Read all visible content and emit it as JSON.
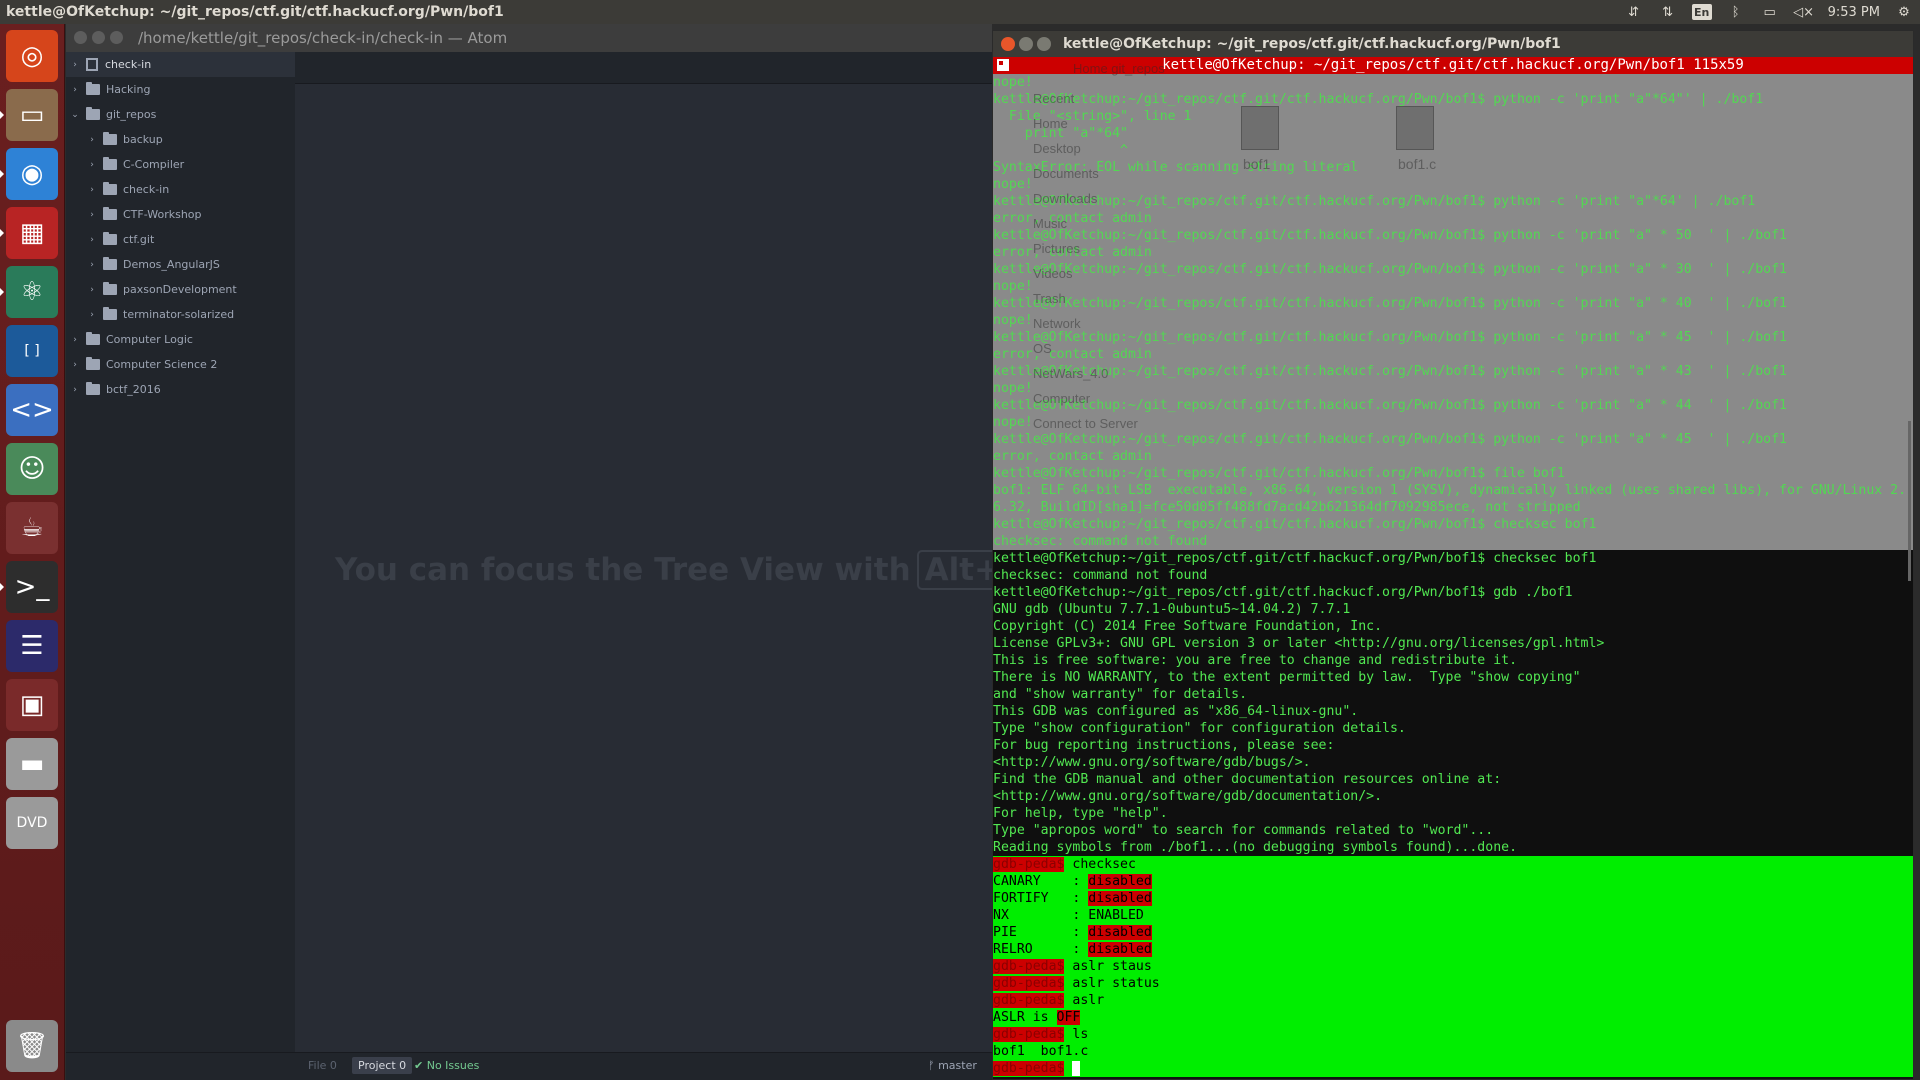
{
  "topbar": {
    "title": "kettle@OfKetchup: ~/git_repos/ctf.git/ctf.hackucf.org/Pwn/bof1",
    "keyboard": "En",
    "time": "9:53 PM",
    "icons": [
      "network-icon",
      "transfer-icon",
      "keyboard-icon",
      "bluetooth-icon",
      "battery-icon",
      "volume-muted-icon",
      "gear-icon"
    ]
  },
  "launcher": {
    "items": [
      {
        "name": "ubuntu-dash-icon",
        "color": "#d6451b",
        "glyph": "◎"
      },
      {
        "name": "files-icon",
        "color": "#8a6b4c",
        "glyph": "▭"
      },
      {
        "name": "chrome-icon",
        "color": "#2e82d6",
        "glyph": "◉"
      },
      {
        "name": "terminator-icon",
        "color": "#b82424",
        "glyph": "▦"
      },
      {
        "name": "atom-icon",
        "color": "#2a7b5a",
        "glyph": "⚛"
      },
      {
        "name": "brackets-icon",
        "color": "#1c5a9a",
        "glyph": "[ ]"
      },
      {
        "name": "code-editor-icon",
        "color": "#3b6fc0",
        "glyph": "<>"
      },
      {
        "name": "game-icon",
        "color": "#4a8a5a",
        "glyph": "☺"
      },
      {
        "name": "java-icon",
        "color": "#7a3030",
        "glyph": "☕"
      },
      {
        "name": "terminal-icon",
        "color": "#2d2d2d",
        "glyph": ">_"
      },
      {
        "name": "eclipse-icon",
        "color": "#2c2a6a",
        "glyph": "☰"
      },
      {
        "name": "workspace-switcher-icon",
        "color": "#7a2a2a",
        "glyph": "▣"
      },
      {
        "name": "drive-icon",
        "color": "#9a9a9a",
        "glyph": "▬"
      },
      {
        "name": "dvd-icon",
        "color": "#9a9a9a",
        "glyph": "DVD"
      },
      {
        "name": "trash-icon",
        "color": "#8a8a8a",
        "glyph": "🗑"
      }
    ]
  },
  "atom": {
    "window_title": "/home/kettle/git_repos/check-in/check-in — Atom",
    "tree": [
      {
        "label": "check-in",
        "depth": 0,
        "chev": "›",
        "type": "repo",
        "selected": true
      },
      {
        "label": "Hacking",
        "depth": 0,
        "chev": "›",
        "type": "folder"
      },
      {
        "label": "git_repos",
        "depth": 0,
        "chev": "⌄",
        "type": "folder"
      },
      {
        "label": "backup",
        "depth": 1,
        "chev": "›",
        "type": "folder"
      },
      {
        "label": "C-Compiler",
        "depth": 1,
        "chev": "›",
        "type": "folder"
      },
      {
        "label": "check-in",
        "depth": 1,
        "chev": "›",
        "type": "folder"
      },
      {
        "label": "CTF-Workshop",
        "depth": 1,
        "chev": "›",
        "type": "folder"
      },
      {
        "label": "ctf.git",
        "depth": 1,
        "chev": "›",
        "type": "folder"
      },
      {
        "label": "Demos_AngularJS",
        "depth": 1,
        "chev": "›",
        "type": "folder"
      },
      {
        "label": "paxsonDevelopment",
        "depth": 1,
        "chev": "›",
        "type": "folder"
      },
      {
        "label": "terminator-solarized",
        "depth": 1,
        "chev": "›",
        "type": "folder"
      },
      {
        "label": "Computer Logic",
        "depth": 0,
        "chev": "›",
        "type": "folder"
      },
      {
        "label": "Computer Science 2",
        "depth": 0,
        "chev": "›",
        "type": "folder"
      },
      {
        "label": "bctf_2016",
        "depth": 0,
        "chev": "›",
        "type": "folder"
      }
    ],
    "hint_text": "You can focus the Tree View with",
    "hint_key": "Alt+\\",
    "status": {
      "file": "File 0",
      "project": "Project 0",
      "issues": "✔ No Issues",
      "branch": "ᚠ master"
    }
  },
  "terminal": {
    "window_title": "kettle@OfKetchup: ~/git_repos/ctf.git/ctf.hackucf.org/Pwn/bof1",
    "tab_title": "kettle@OfKetchup: ~/git_repos/ctf.git/ctf.hackucf.org/Pwn/bof1 115x59",
    "nautilus_ghost": [
      "Recent",
      "Home",
      "Desktop",
      "Documents",
      "Downloads",
      "Music",
      "Pictures",
      "Videos",
      "Trash",
      "Network",
      "OS",
      "NetWars_4.0",
      "Computer",
      "Connect to Server"
    ],
    "nautilus_path": "Home  git_repos",
    "ghost_files": [
      "bof1",
      "bof1.c"
    ],
    "lines_gray": [
      "nope!",
      "kettle@OfKetchup:~/git_repos/ctf.git/ctf.hackucf.org/Pwn/bof1$ python -c 'print \"a\"*64\"' | ./bof1",
      "  File \"<string>\", line 1",
      "    print \"a\"*64\"",
      "                ^",
      "SyntaxError: EOL while scanning string literal",
      "nope!",
      "kettle@OfKetchup:~/git_repos/ctf.git/ctf.hackucf.org/Pwn/bof1$ python -c 'print \"a\"*64' | ./bof1",
      "error, contact admin",
      "kettle@OfKetchup:~/git_repos/ctf.git/ctf.hackucf.org/Pwn/bof1$ python -c 'print \"a\" * 50  ' | ./bof1",
      "error, contact admin",
      "kettle@OfKetchup:~/git_repos/ctf.git/ctf.hackucf.org/Pwn/bof1$ python -c 'print \"a\" * 30  ' | ./bof1",
      "nope!",
      "kettle@OfKetchup:~/git_repos/ctf.git/ctf.hackucf.org/Pwn/bof1$ python -c 'print \"a\" * 40  ' | ./bof1",
      "nope!",
      "kettle@OfKetchup:~/git_repos/ctf.git/ctf.hackucf.org/Pwn/bof1$ python -c 'print \"a\" * 45  ' | ./bof1",
      "error, contact admin",
      "kettle@OfKetchup:~/git_repos/ctf.git/ctf.hackucf.org/Pwn/bof1$ python -c 'print \"a\" * 43  ' | ./bof1",
      "nope!",
      "kettle@OfKetchup:~/git_repos/ctf.git/ctf.hackucf.org/Pwn/bof1$ python -c 'print \"a\" * 44  ' | ./bof1",
      "nope!",
      "kettle@OfKetchup:~/git_repos/ctf.git/ctf.hackucf.org/Pwn/bof1$ python -c 'print \"a\" * 45  ' | ./bof1",
      "error, contact admin",
      "kettle@OfKetchup:~/git_repos/ctf.git/ctf.hackucf.org/Pwn/bof1$ file bof1",
      "bof1: ELF 64-bit LSB  executable, x86-64, version 1 (SYSV), dynamically linked (uses shared libs), for GNU/Linux 2.",
      "6.32, BuildID[sha1]=fce50d05ff488fd7acd42b621364df7092985ece, not stripped",
      "kettle@OfKetchup:~/git_repos/ctf.git/ctf.hackucf.org/Pwn/bof1$ checksec bof1",
      "checksec: command not found"
    ],
    "lines_black": [
      "kettle@OfKetchup:~/git_repos/ctf.git/ctf.hackucf.org/Pwn/bof1$ checksec bof1",
      "checksec: command not found",
      "kettle@OfKetchup:~/git_repos/ctf.git/ctf.hackucf.org/Pwn/bof1$ gdb ./bof1",
      "GNU gdb (Ubuntu 7.7.1-0ubuntu5~14.04.2) 7.7.1",
      "Copyright (C) 2014 Free Software Foundation, Inc.",
      "License GPLv3+: GNU GPL version 3 or later <http://gnu.org/licenses/gpl.html>",
      "This is free software: you are free to change and redistribute it.",
      "There is NO WARRANTY, to the extent permitted by law.  Type \"show copying\"",
      "and \"show warranty\" for details.",
      "This GDB was configured as \"x86_64-linux-gnu\".",
      "Type \"show configuration\" for configuration details.",
      "For bug reporting instructions, please see:",
      "<http://www.gnu.org/software/gdb/bugs/>.",
      "Find the GDB manual and other documentation resources online at:",
      "<http://www.gnu.org/software/gdb/documentation/>.",
      "For help, type \"help\".",
      "Type \"apropos word\" to search for commands related to \"word\"...",
      "Reading symbols from ./bof1...(no debugging symbols found)...done."
    ],
    "gdb_lines": [
      {
        "prompt": "gdb-peda$",
        "text": " checksec"
      },
      {
        "label": "CANARY    : ",
        "value": "disabled",
        "red": true
      },
      {
        "label": "FORTIFY   : ",
        "value": "disabled",
        "red": true
      },
      {
        "label": "NX        : ",
        "value": "ENABLED",
        "red": false
      },
      {
        "label": "PIE       : ",
        "value": "disabled",
        "red": true
      },
      {
        "label": "RELRO     : ",
        "value": "disabled",
        "red": true
      },
      {
        "prompt": "gdb-peda$",
        "text": " aslr staus"
      },
      {
        "prompt": "gdb-peda$",
        "text": " aslr status"
      },
      {
        "prompt": "gdb-peda$",
        "text": " aslr"
      },
      {
        "label": "ASLR is ",
        "value": "OFF",
        "red": true
      },
      {
        "prompt": "gdb-peda$",
        "text": " ls"
      },
      {
        "label": "bof1  bof1.c",
        "value": "",
        "red": false
      },
      {
        "prompt": "gdb-peda$",
        "text": " ",
        "cursor": true
      }
    ]
  }
}
